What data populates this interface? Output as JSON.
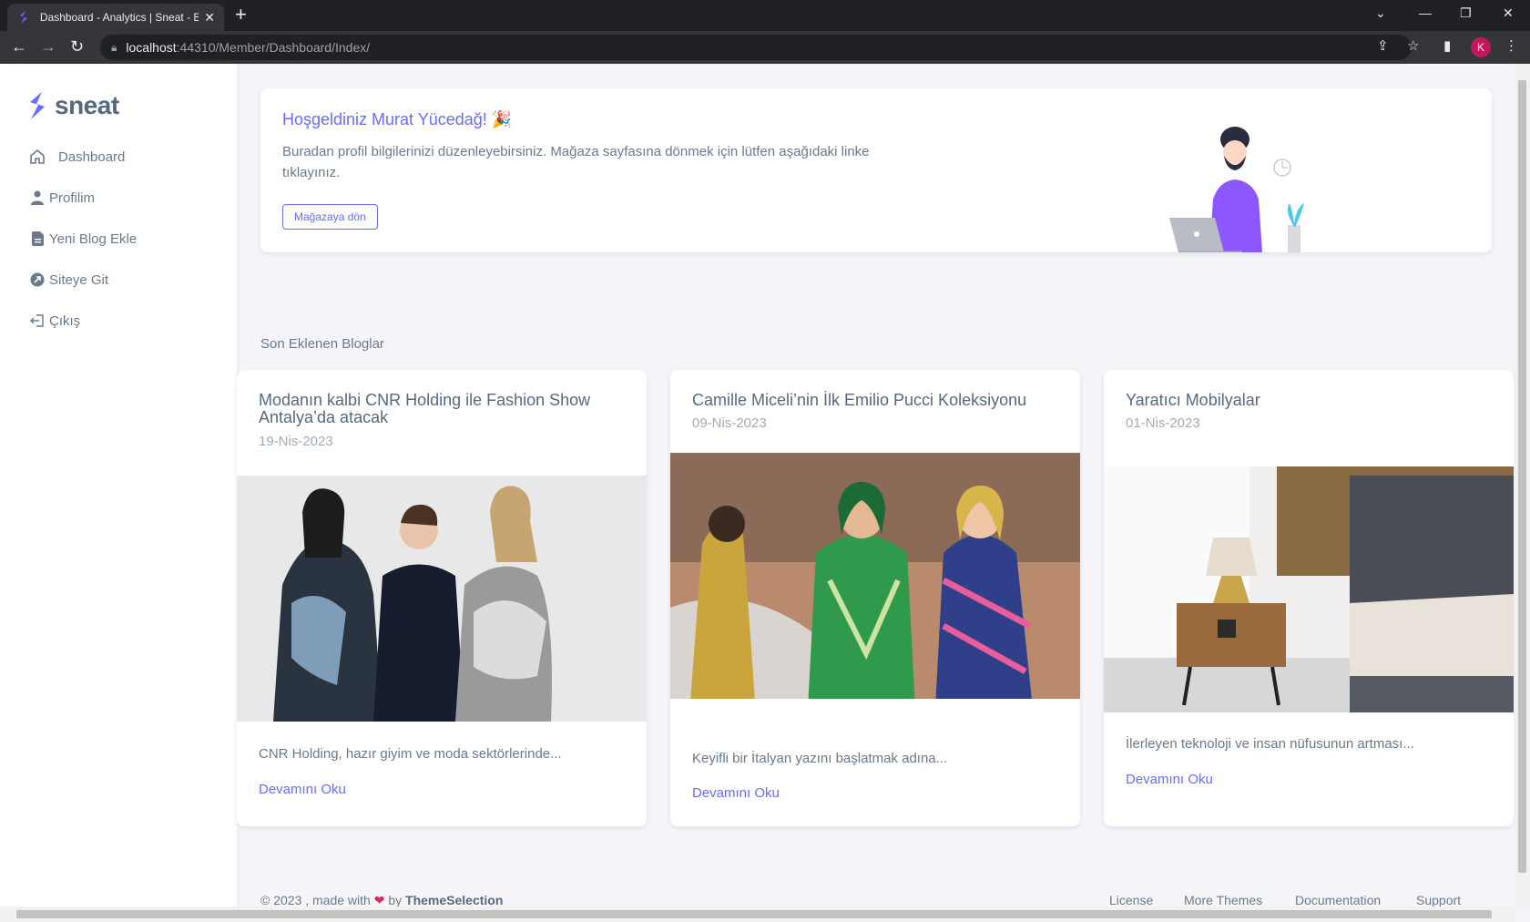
{
  "browser": {
    "tab_title": "Dashboard - Analytics | Sneat - B",
    "url_host": "localhost",
    "url_rest": ":44310/Member/Dashboard/Index/",
    "profile_initial": "K"
  },
  "sidebar": {
    "brand": "sneat",
    "items": [
      {
        "label": "Dashboard",
        "icon": "home-icon"
      },
      {
        "label": "Profilim",
        "icon": "user-icon"
      },
      {
        "label": "Yeni Blog Ekle",
        "icon": "file-icon"
      },
      {
        "label": "Siteye Git",
        "icon": "external-link-icon"
      },
      {
        "label": "Çıkış",
        "icon": "logout-icon"
      }
    ]
  },
  "welcome": {
    "title": "Hoşgeldiniz Murat Yücedağ! 🎉",
    "text": "Buradan profil bilgilerinizi düzenleyebirsiniz. Mağaza sayfasına dönmek için lütfen aşağıdaki linke tıklayınız.",
    "button": "Mağazaya dön"
  },
  "section_title": "Son Eklenen Bloglar",
  "blogs": [
    {
      "title": "Modanın kalbi CNR Holding ile Fashion Show Antalya’da atacak",
      "date": "19-Nis-2023",
      "excerpt": "CNR Holding, hazır giyim ve moda sektörlerinde...",
      "link": "Devamını Oku"
    },
    {
      "title": "Camille Miceli’nin İlk Emilio Pucci Koleksiyonu",
      "date": "09-Nis-2023",
      "excerpt": "Keyifli bir İtalyan yazını başlatmak adına...",
      "link": "Devamını Oku"
    },
    {
      "title": "Yaratıcı Mobilyalar",
      "date": "01-Nis-2023",
      "excerpt": "İlerleyen teknoloji ve insan nüfusunun artması...",
      "link": "Devamını Oku"
    }
  ],
  "footer": {
    "copyright": "© 2023 , made with",
    "by": "by",
    "brand": "ThemeSelection",
    "links": [
      "License",
      "More Themes",
      "Documentation",
      "Support"
    ]
  },
  "colors": {
    "accent": "#696cff",
    "text": "#697a8d",
    "bg": "#f5f5f9"
  }
}
